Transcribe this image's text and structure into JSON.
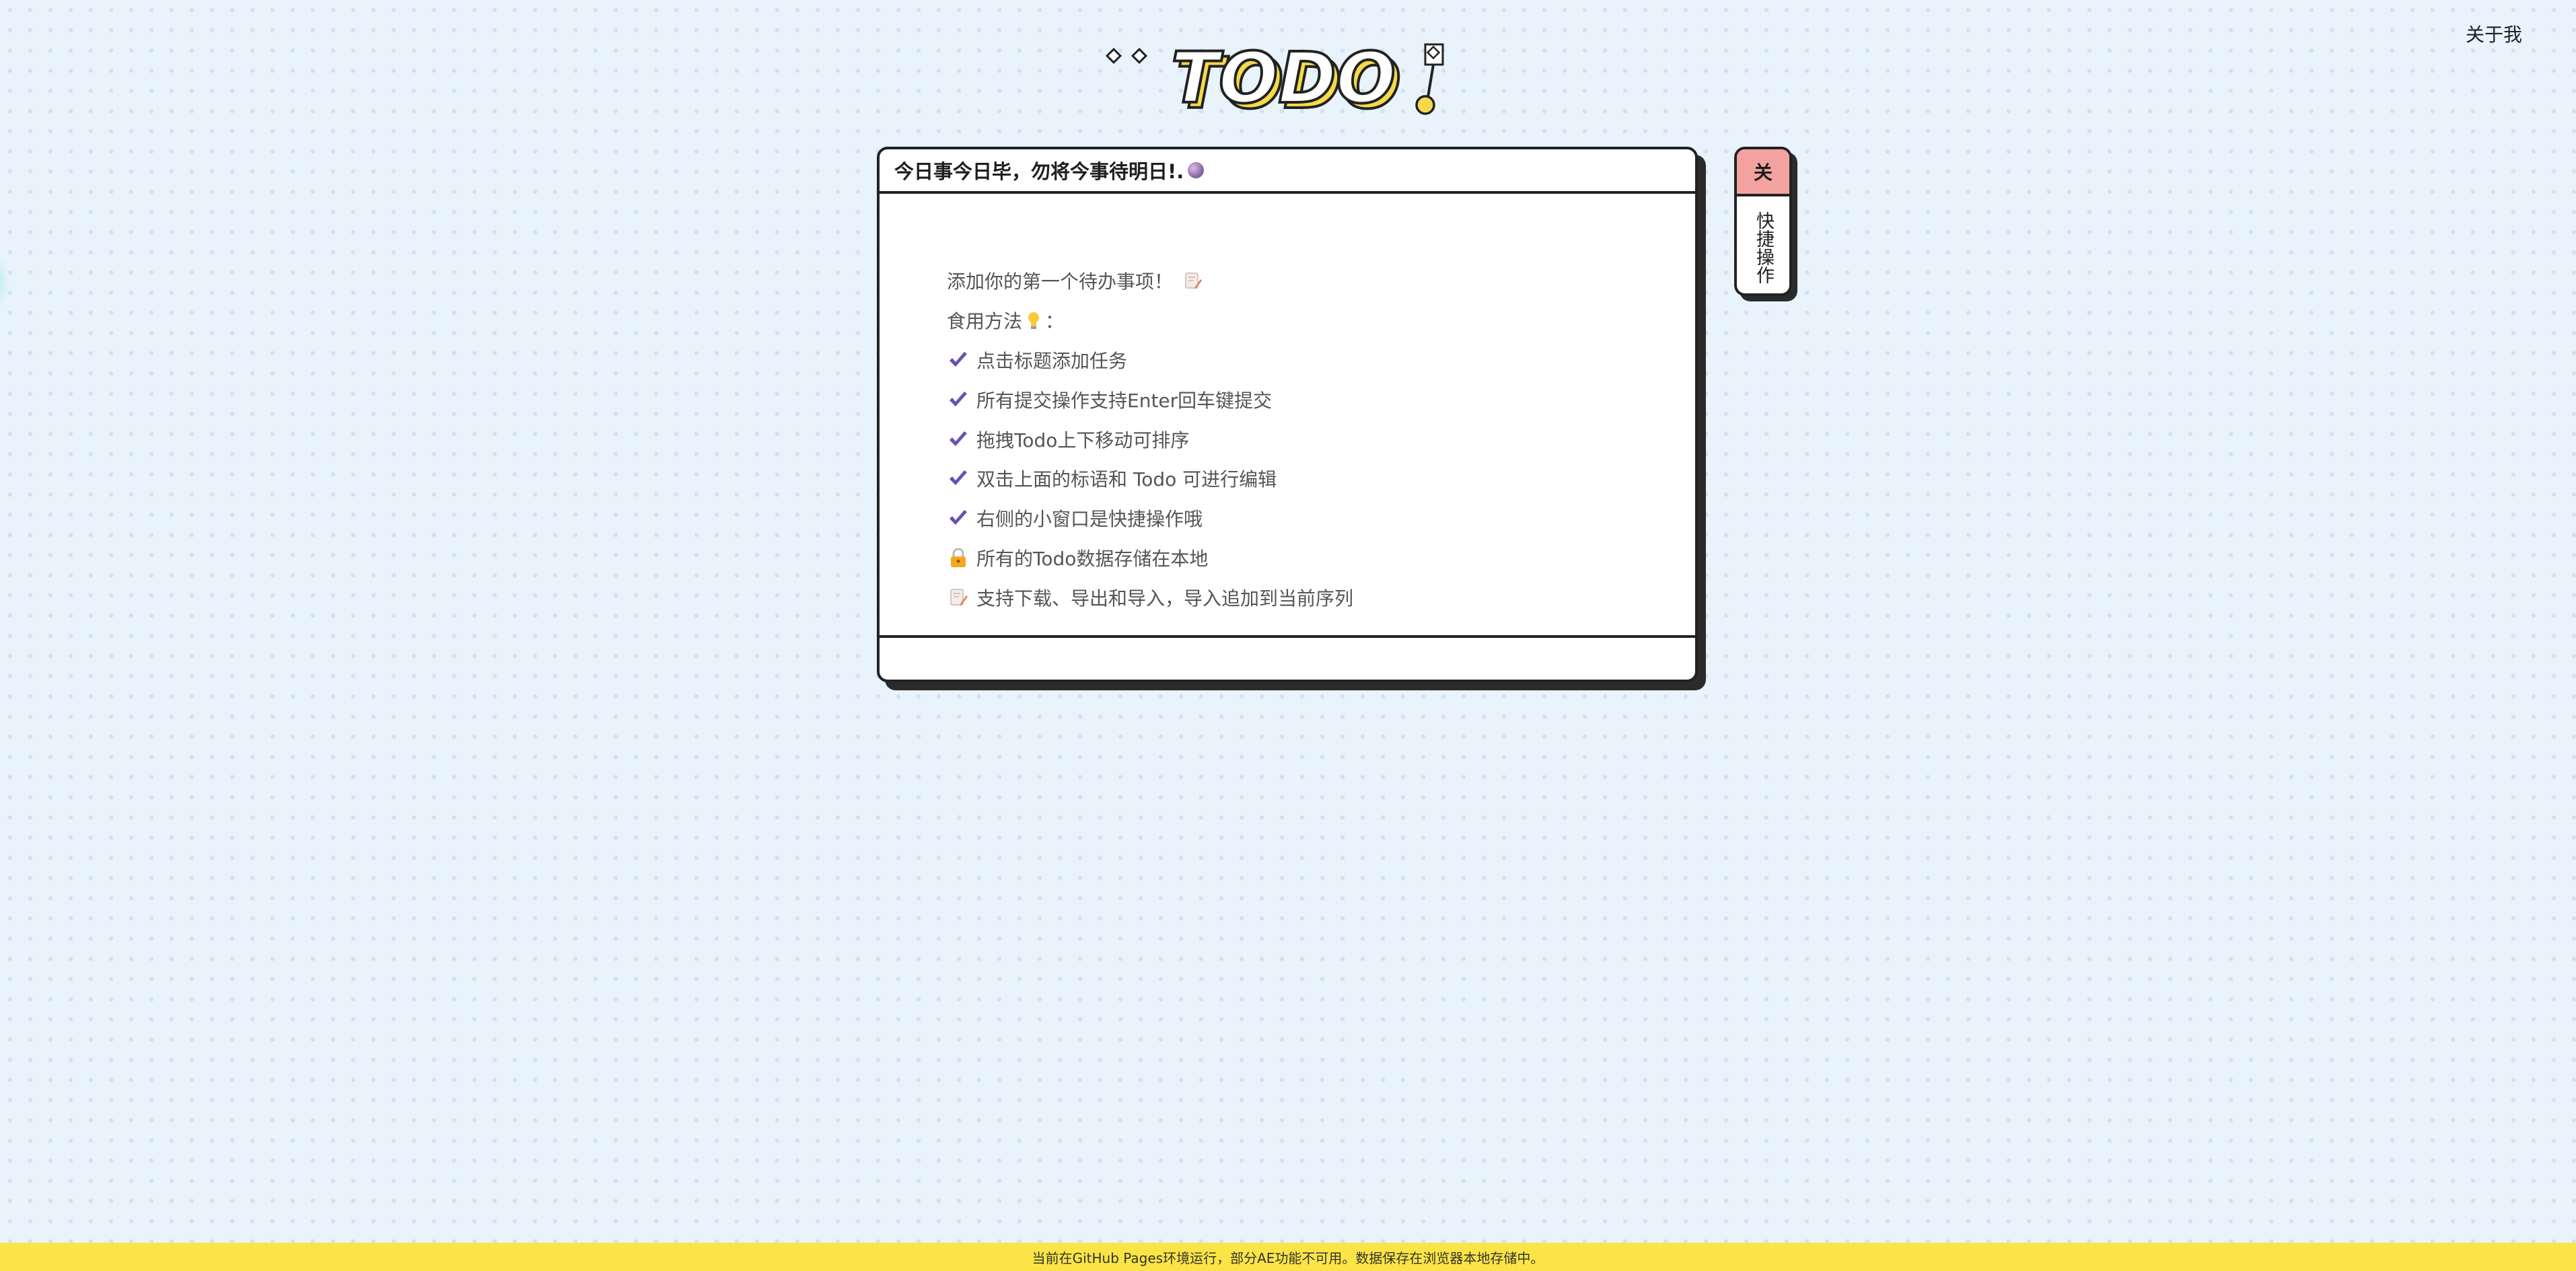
{
  "nav": {
    "about": "关于我"
  },
  "logo": {
    "text": "TODO"
  },
  "card": {
    "title": "今日事今日毕，勿将今事待明日!.",
    "intro": "添加你的第一个待办事项！",
    "usage_label": "食用方法",
    "usage_suffix": "：",
    "tips": [
      {
        "icon": "check-icon",
        "text": "点击标题添加任务"
      },
      {
        "icon": "check-icon",
        "text": "所有提交操作支持Enter回车键提交"
      },
      {
        "icon": "check-icon",
        "text": "拖拽Todo上下移动可排序"
      },
      {
        "icon": "check-icon",
        "text": "双击上面的标语和 Todo 可进行编辑"
      },
      {
        "icon": "check-icon",
        "text": "右侧的小窗口是快捷操作哦"
      },
      {
        "icon": "lock-icon",
        "text": "所有的Todo数据存储在本地"
      },
      {
        "icon": "memo-icon",
        "text": "支持下载、导出和导入，导入追加到当前序列"
      }
    ]
  },
  "quick_panel": {
    "close_label": "关",
    "title": "快捷操作"
  },
  "status_bar": {
    "message": "当前在GitHub Pages环境运行，部分AE功能不可用。数据保存在浏览器本地存储中。"
  },
  "colors": {
    "background": "#e9f3fb",
    "accent_yellow": "#fbe445",
    "close_red": "#f2a39f",
    "check_purple": "#6a4fb3"
  }
}
